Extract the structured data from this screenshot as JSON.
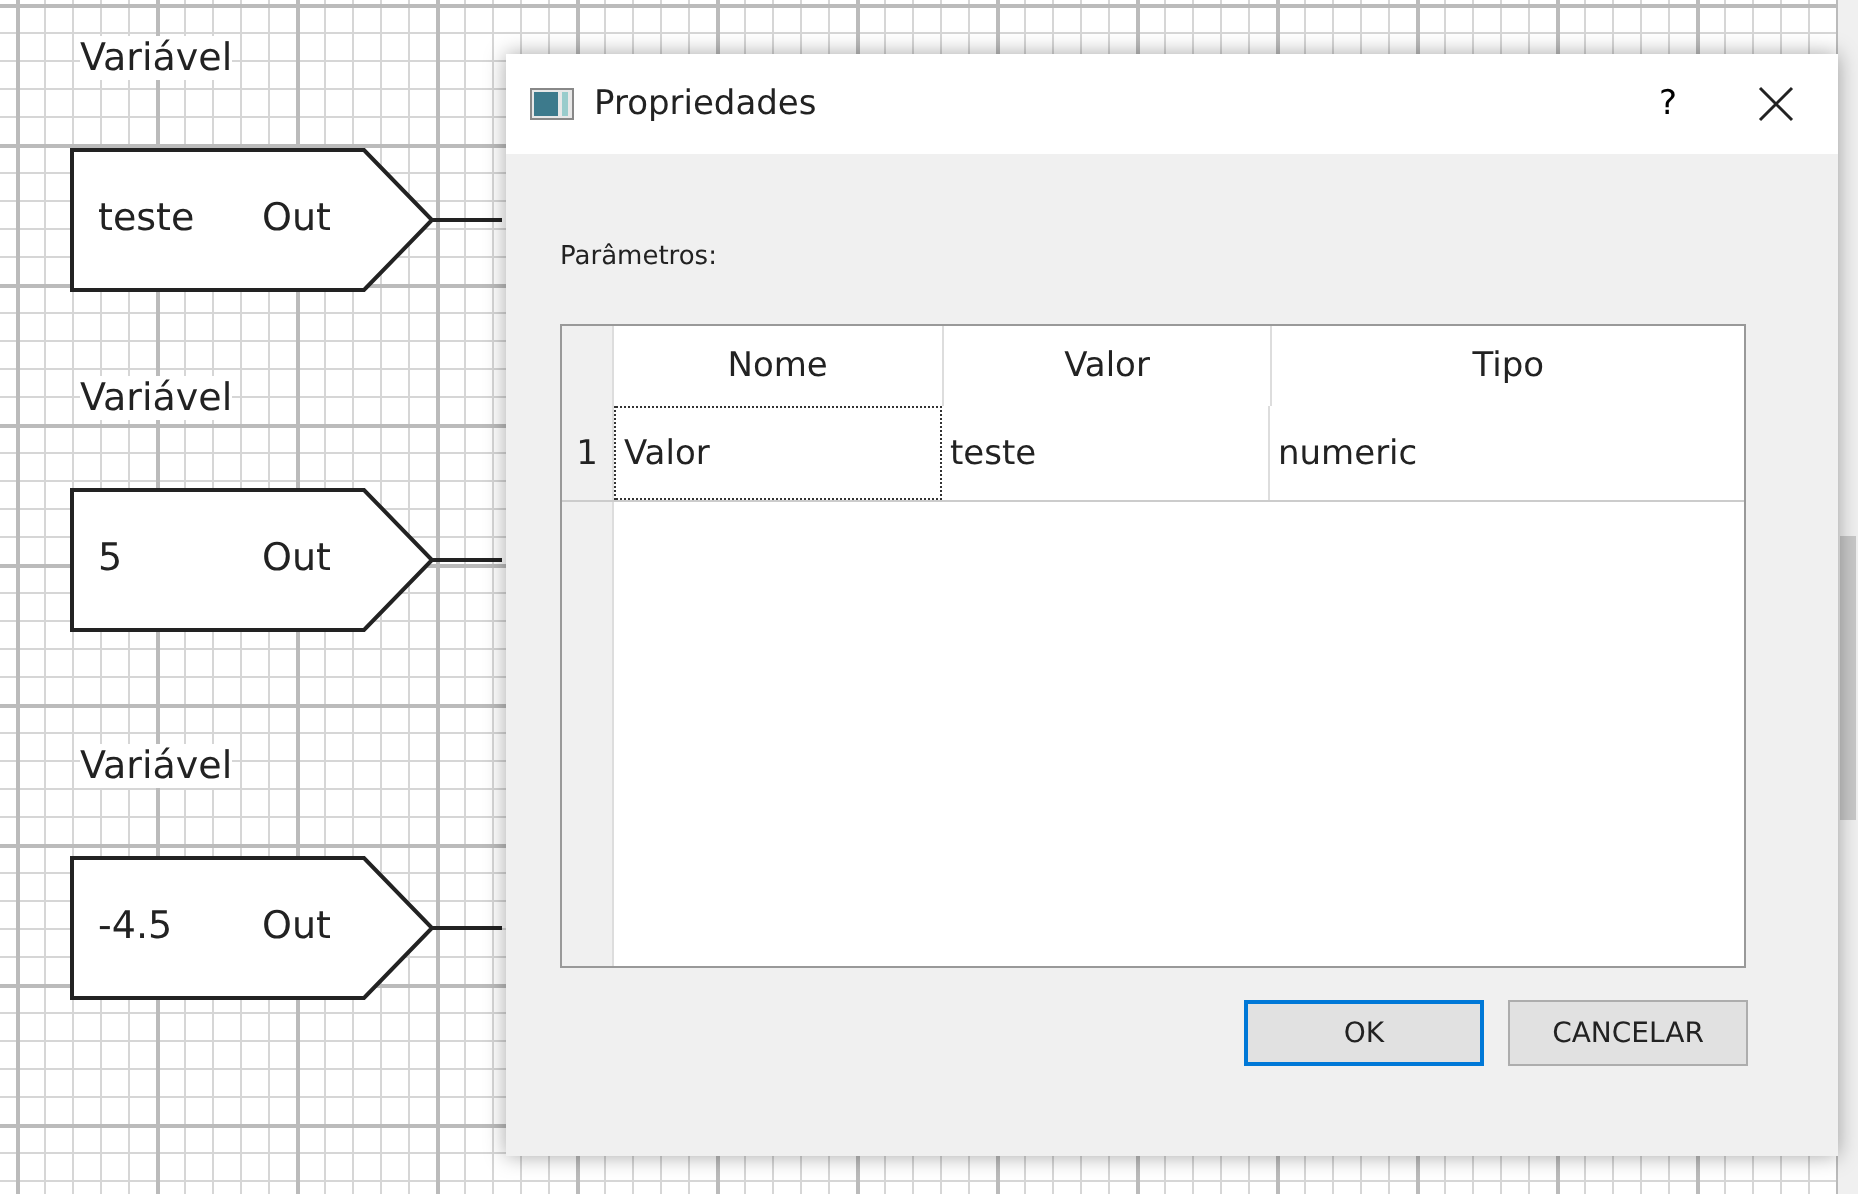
{
  "canvas": {
    "nodes": [
      {
        "title": "Variável",
        "value": "teste",
        "port": "Out"
      },
      {
        "title": "Variável",
        "value": "5",
        "port": "Out"
      },
      {
        "title": "Variável",
        "value": "-4.5",
        "port": "Out"
      }
    ]
  },
  "dialog": {
    "title": "Propriedades",
    "help": "?",
    "section_label": "Parâmetros:",
    "table": {
      "columns": [
        "Nome",
        "Valor",
        "Tipo"
      ],
      "rows": [
        {
          "number": "1",
          "cells": [
            {
              "text": "Valor",
              "focused": true
            },
            {
              "text": "teste",
              "focused": false
            },
            {
              "text": "numeric",
              "focused": false
            }
          ]
        }
      ]
    },
    "buttons": [
      {
        "label": "OK",
        "default": true
      },
      {
        "label": "CANCELAR",
        "default": false
      }
    ]
  }
}
